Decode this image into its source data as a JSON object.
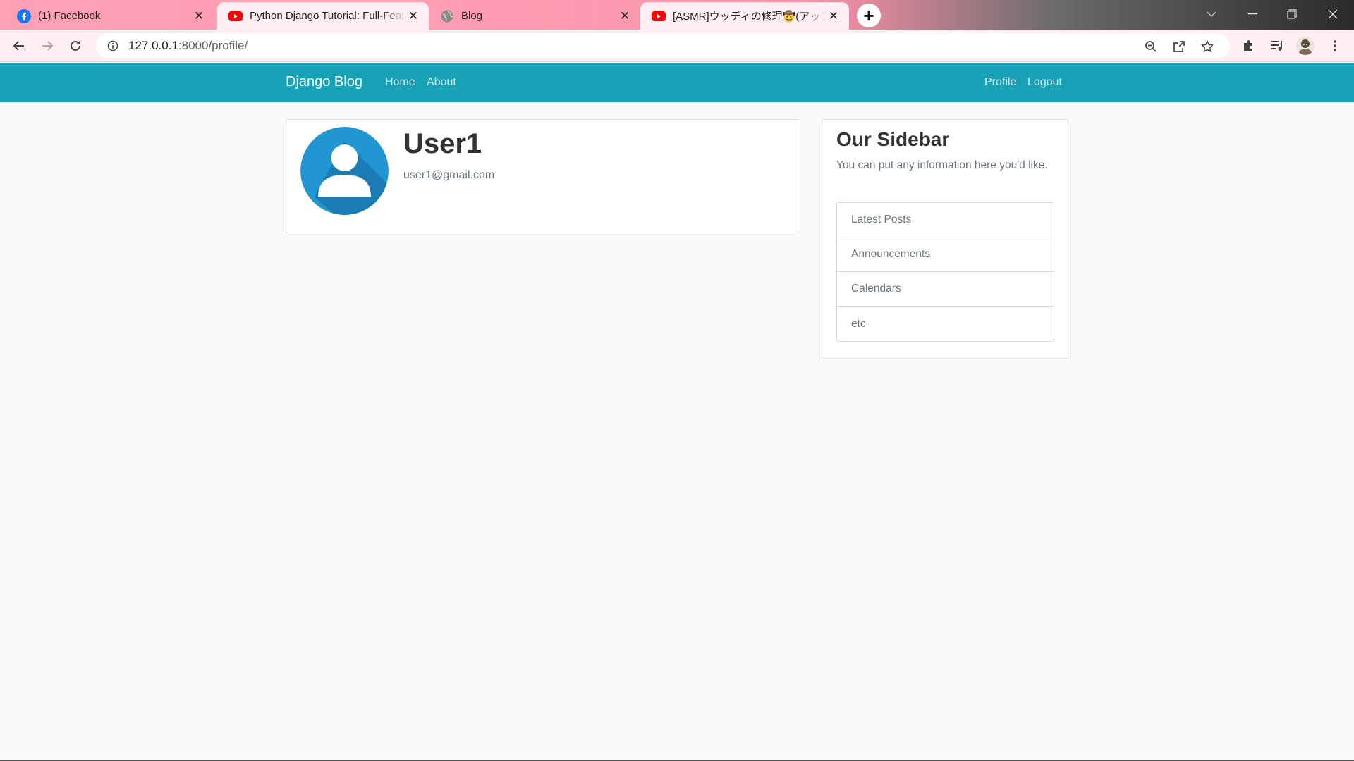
{
  "browser": {
    "tabs": [
      {
        "title": "(1) Facebook",
        "icon": "facebook-icon",
        "active": false
      },
      {
        "title": "Python Django Tutorial: Full-Featured Web App",
        "icon": "youtube-icon",
        "active": true
      },
      {
        "title": "Blog",
        "icon": "globe-icon",
        "active": false
      },
      {
        "title": "[ASMR]ウッディの修理🤠(アップグレード)",
        "icon": "youtube-icon",
        "active": true
      }
    ],
    "url_host": "127.0.0.1",
    "url_rest": ":8000/profile/",
    "colors": {
      "tabstrip": "#ff9cb1",
      "toolbar": "#ffeef2"
    }
  },
  "site": {
    "brand": "Django Blog",
    "nav_left": [
      "Home",
      "About"
    ],
    "nav_right": [
      "Profile",
      "Logout"
    ],
    "navbar_color": "#17a2b8"
  },
  "profile": {
    "username": "User1",
    "email": "user1@gmail.com",
    "avatar_color": "#2196d3"
  },
  "sidebar": {
    "title": "Our Sidebar",
    "description": "You can put any information here you'd like.",
    "items": [
      "Latest Posts",
      "Announcements",
      "Calendars",
      "etc"
    ]
  }
}
